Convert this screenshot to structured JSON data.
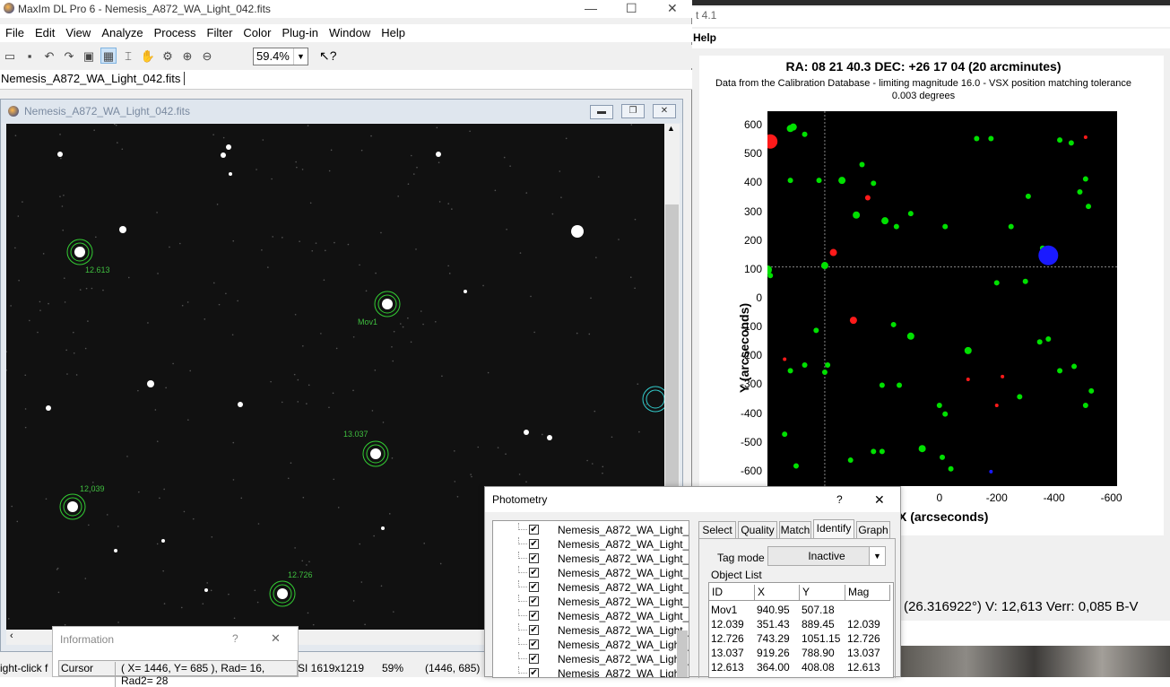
{
  "right_app": {
    "title_fragment": "t 4.1",
    "menu_fragment": "Help",
    "plot": {
      "title": "RA: 08 21 40.3  DEC: +26 17 04 (20 arcminutes)",
      "subtitle_line1": "Data from the Calibration Database - limiting magnitude 16.0 - VSX position matching tolerance",
      "subtitle_line2": "0.003 degrees",
      "ylabel": "Y (arcseconds)",
      "xlabel": "X (arcseconds)",
      "y_ticks": [
        "600",
        "500",
        "400",
        "300",
        "200",
        "100",
        "0",
        "-100",
        "-200",
        "-300",
        "-400",
        "-500",
        "-600"
      ],
      "x_ticks": [
        "0",
        "-200",
        "-400",
        "-600"
      ]
    },
    "status_text": "(26.316922°)   V: 12,613   Verr: 0,085   B-V"
  },
  "chart_data": {
    "type": "scatter",
    "title": "RA: 08 21 40.3  DEC: +26 17 04 (20 arcminutes)",
    "xlabel": "X (arcseconds)",
    "ylabel": "Y (arcseconds)",
    "xlim": [
      600,
      -620
    ],
    "ylim": [
      -650,
      650
    ],
    "crosshair": {
      "x": 400,
      "y": 110
    },
    "series": [
      {
        "color": "#00e000",
        "points": [
          [
            520,
            590
          ],
          [
            470,
            570
          ],
          [
            510,
            595
          ],
          [
            420,
            410
          ],
          [
            340,
            410
          ],
          [
            270,
            465
          ],
          [
            230,
            400
          ],
          [
            190,
            270
          ],
          [
            150,
            250
          ],
          [
            100,
            295
          ],
          [
            -20,
            250
          ],
          [
            -130,
            555
          ],
          [
            -180,
            555
          ],
          [
            -250,
            250
          ],
          [
            -310,
            355
          ],
          [
            -420,
            550
          ],
          [
            -460,
            540
          ],
          [
            -490,
            370
          ],
          [
            -510,
            415
          ],
          [
            -520,
            320
          ],
          [
            -360,
            175
          ],
          [
            -200,
            55
          ],
          [
            -300,
            60
          ],
          [
            -380,
            -140
          ],
          [
            -350,
            -150
          ],
          [
            -420,
            -250
          ],
          [
            -470,
            -235
          ],
          [
            -510,
            -370
          ],
          [
            -530,
            -320
          ],
          [
            -280,
            -340
          ],
          [
            -100,
            -180
          ],
          [
            -20,
            -400
          ],
          [
            -10,
            -550
          ],
          [
            -40,
            -590
          ],
          [
            60,
            -520
          ],
          [
            0,
            -370
          ],
          [
            100,
            -130
          ],
          [
            140,
            -300
          ],
          [
            230,
            -530
          ],
          [
            200,
            -530
          ],
          [
            500,
            -580
          ],
          [
            470,
            -230
          ],
          [
            520,
            -250
          ],
          [
            540,
            -470
          ],
          [
            400,
            -255
          ],
          [
            390,
            -230
          ],
          [
            430,
            -110
          ],
          [
            590,
            80
          ],
          [
            600,
            100
          ],
          [
            400,
            115
          ],
          [
            520,
            410
          ],
          [
            290,
            290
          ],
          [
            310,
            -560
          ],
          [
            160,
            -90
          ],
          [
            200,
            -300
          ]
        ],
        "sizes": [
          4,
          3,
          4,
          3,
          4,
          3,
          3,
          4,
          3,
          3,
          3,
          3,
          3,
          3,
          3,
          3,
          3,
          3,
          3,
          3,
          3,
          3,
          3,
          3,
          3,
          3,
          3,
          3,
          3,
          3,
          4,
          3,
          3,
          3,
          4,
          3,
          4,
          3,
          3,
          3,
          3,
          3,
          3,
          3,
          3,
          3,
          3,
          3,
          5,
          4,
          3,
          4,
          3,
          3,
          3
        ]
      },
      {
        "color": "#ff1a1a",
        "points": [
          [
            590,
            545
          ],
          [
            370,
            160
          ],
          [
            300,
            -75
          ],
          [
            250,
            350
          ],
          [
            -220,
            -270
          ],
          [
            -200,
            -370
          ],
          [
            -100,
            -280
          ],
          [
            -510,
            560
          ],
          [
            540,
            -210
          ]
        ],
        "sizes": [
          8,
          4,
          4,
          3,
          2,
          2,
          2,
          2,
          2
        ]
      },
      {
        "color": "#1a1aff",
        "points": [
          [
            -380,
            150
          ],
          [
            -180,
            -600
          ]
        ],
        "sizes": [
          11,
          2
        ]
      }
    ]
  },
  "maxim": {
    "title": "MaxIm DL Pro 6 - Nemesis_A872_WA_Light_042.fits",
    "menu": [
      "File",
      "Edit",
      "View",
      "Analyze",
      "Process",
      "Filter",
      "Color",
      "Plug-in",
      "Window",
      "Help"
    ],
    "zoom": "59.4%",
    "tab_label": "Nemesis_A872_WA_Light_042.fits",
    "image_window_title": "Nemesis_A872_WA_Light_042.fits",
    "annotations": [
      {
        "label": "12.613"
      },
      {
        "label": "Mov1"
      },
      {
        "label": "13.037"
      },
      {
        "label": "12.039"
      },
      {
        "label": "12.726"
      }
    ],
    "status_left": "ight-click f",
    "status_image": "SI 1619x1219",
    "status_zoom": "59%",
    "status_coords": "(1446, 685)"
  },
  "info": {
    "title": "Information",
    "help": "?",
    "close": "✕",
    "mode": "Cursor",
    "readout": "( X= 1446, Y=  685 ), Rad= 16, Rad2= 28"
  },
  "photometry": {
    "title": "Photometry",
    "help": "?",
    "close": "✕",
    "files": [
      "Nemesis_A872_WA_Light_",
      "Nemesis_A872_WA_Light_",
      "Nemesis_A872_WA_Light_",
      "Nemesis_A872_WA_Light_",
      "Nemesis_A872_WA_Light_",
      "Nemesis_A872_WA_Light_",
      "Nemesis_A872_WA_Light_",
      "Nemesis_A872_WA_Light_",
      "Nemesis_A872_WA_Light_",
      "Nemesis_A872_WA_Light_",
      "Nemesis_A872_WA_Light_"
    ],
    "tabs": [
      "Select",
      "Quality",
      "Match",
      "Identify",
      "Graph"
    ],
    "tag_mode_label": "Tag mode",
    "tag_mode_value": "Inactive",
    "object_list_label": "Object List",
    "columns": [
      "ID",
      "X",
      "Y",
      "Mag"
    ],
    "rows": [
      [
        "Mov1",
        "940.95",
        "507.18",
        ""
      ],
      [
        "12.039",
        "351.43",
        "889.45",
        "12.039"
      ],
      [
        "12.726",
        "743.29",
        "1051.15",
        "12.726"
      ],
      [
        "13.037",
        "919.26",
        "788.90",
        "13.037"
      ],
      [
        "12.613",
        "364.00",
        "408.08",
        "12.613"
      ]
    ]
  }
}
